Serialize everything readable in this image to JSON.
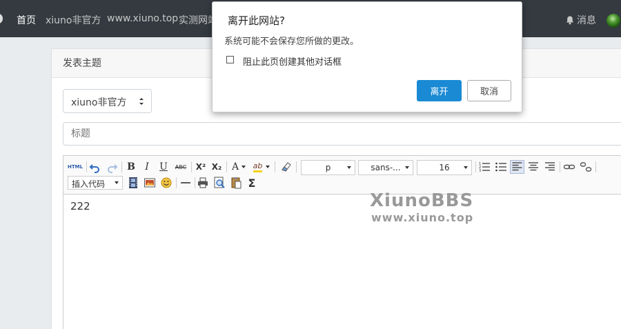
{
  "nav": {
    "items": [
      {
        "label": "首页",
        "active": true
      },
      {
        "label": "xiuno非官方",
        "active": false
      },
      {
        "label": "www.xiuno.top",
        "active": false
      },
      {
        "label": "实测网站",
        "active": false
      }
    ],
    "messages_label": "消息"
  },
  "card": {
    "header_title": "发表主题",
    "forum_select_value": "xiuno非官方",
    "title_placeholder": "标题"
  },
  "editor": {
    "html_label": "HTML",
    "bold": "B",
    "italic": "I",
    "underline": "U",
    "strike": "ABC",
    "superscript": "X²",
    "subscript": "X₂",
    "font_color": "A",
    "highlight": "ab",
    "paragraph_format": "p",
    "font_family": "sans-...",
    "font_size": "16",
    "insert_code": "插入代码",
    "sigma": "Σ",
    "content": "222"
  },
  "watermark": {
    "line1": "XiunoBBS",
    "line2": "www.xiuno.top"
  },
  "dialog": {
    "title": "离开此网站?",
    "message": "系统可能不会保存您所做的更改。",
    "checkbox_label": "阻止此页创建其他对话框",
    "leave_button": "离开",
    "cancel_button": "取消"
  },
  "colors": {
    "navbar_bg": "#343a40",
    "primary_button": "#1a8ad4",
    "page_bg": "#e9ecef"
  }
}
